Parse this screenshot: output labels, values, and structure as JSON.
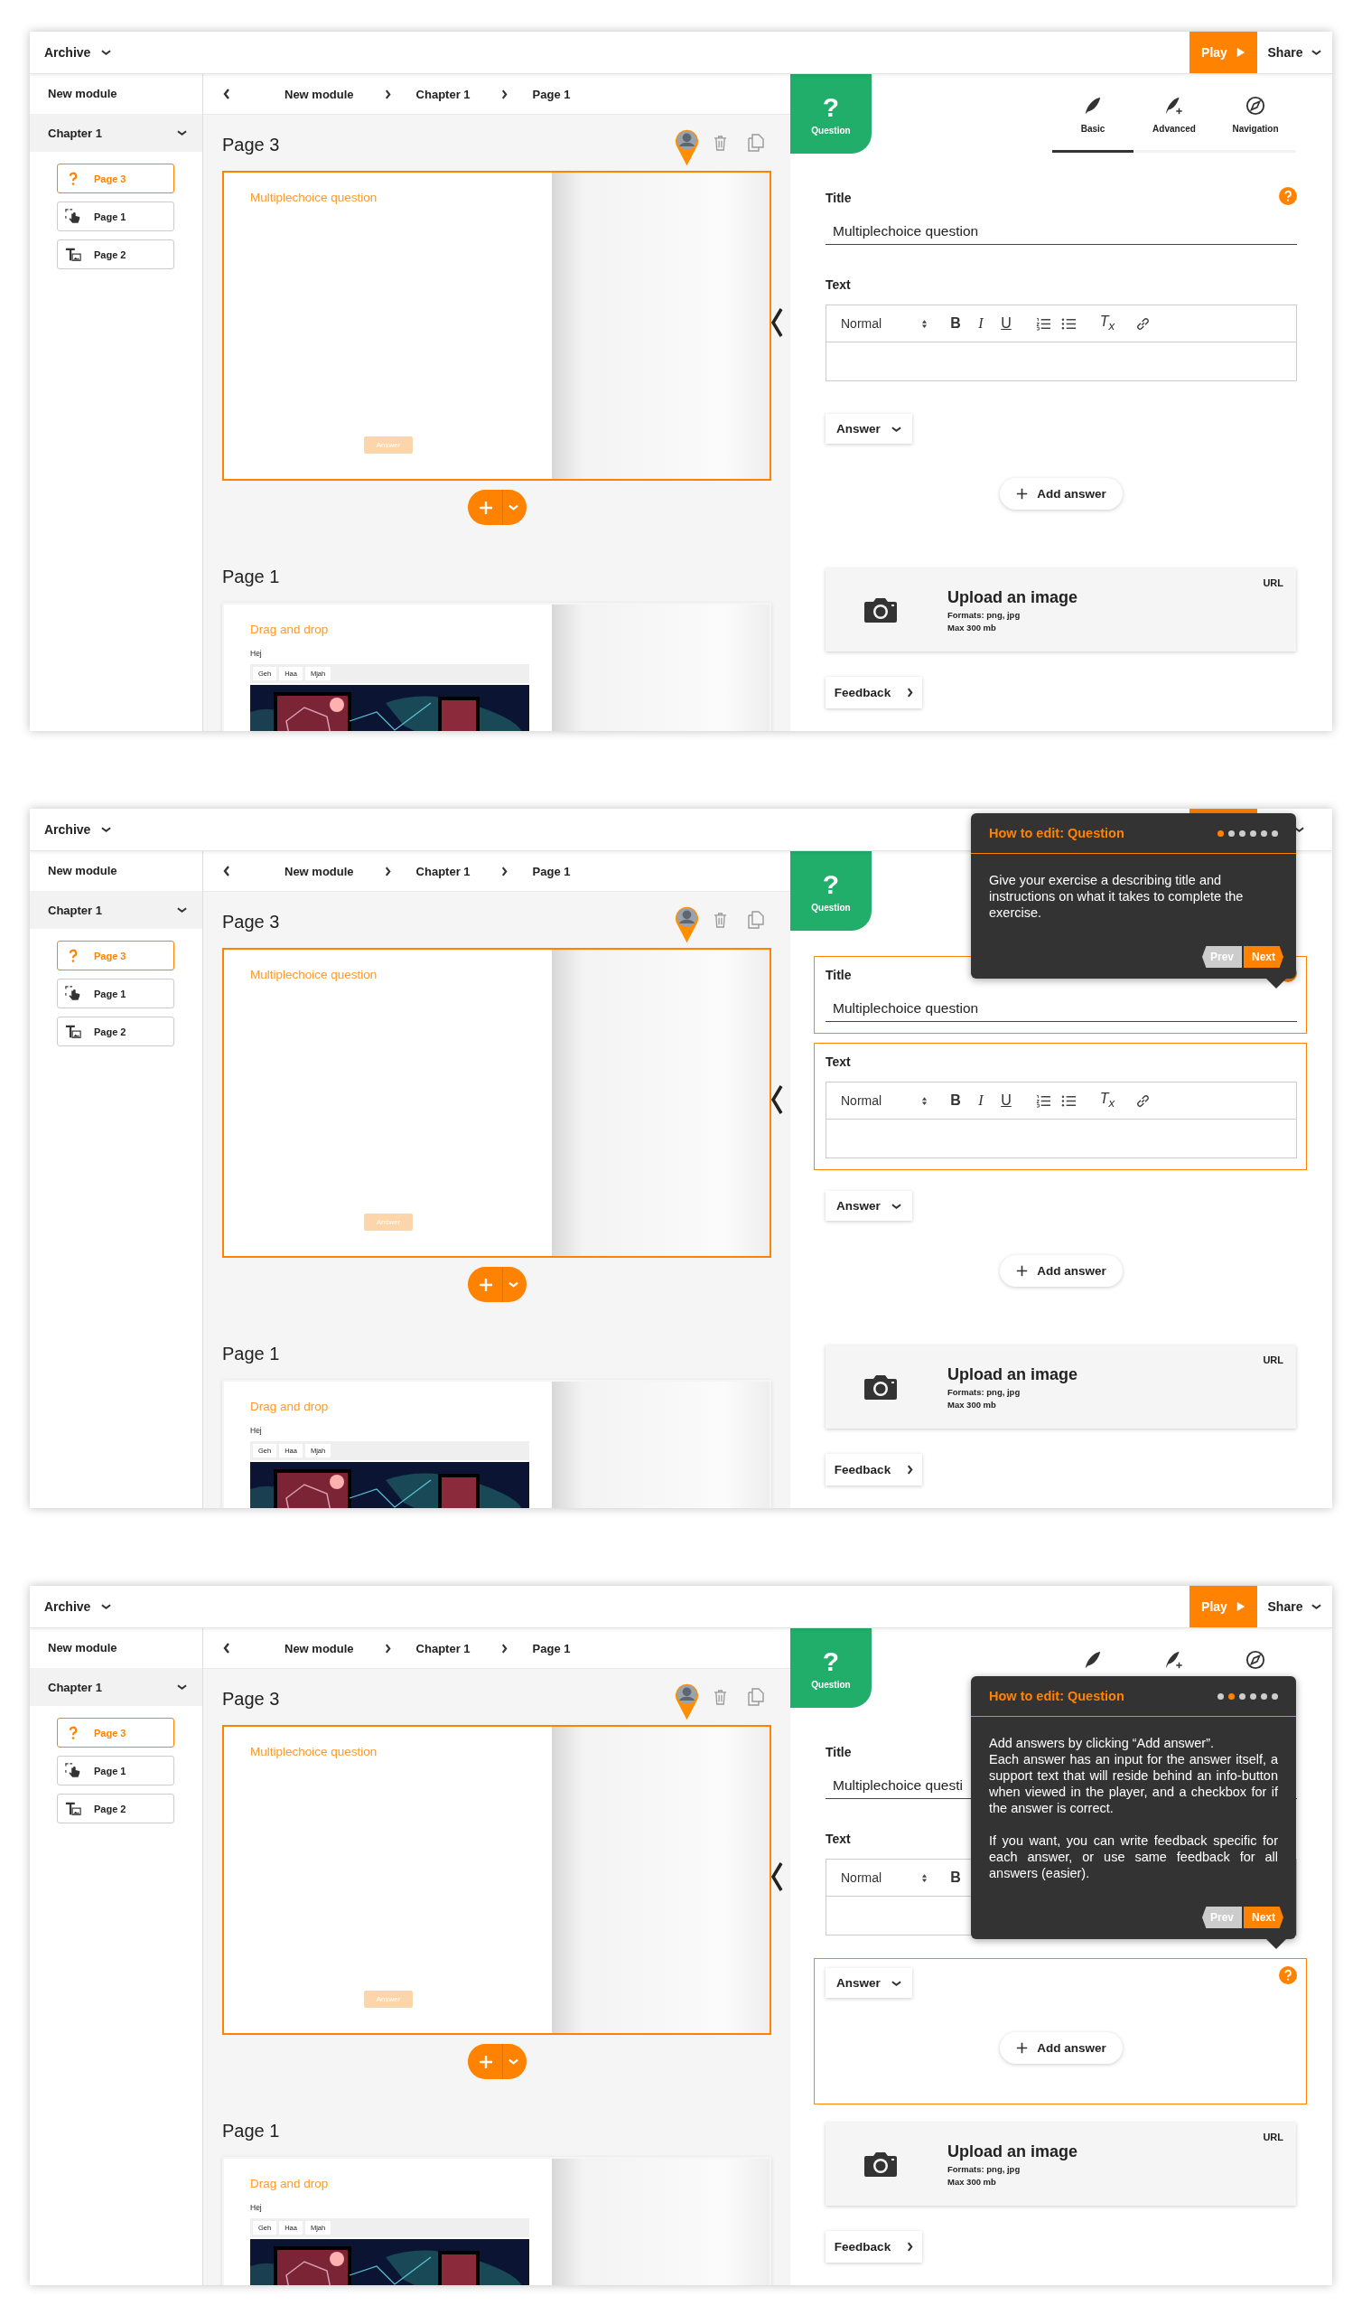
{
  "screens": [
    {
      "topbar": {
        "archive": "Archive",
        "play": "Play",
        "share": "Share"
      },
      "sidebar": {
        "module": "New module",
        "chapter": {
          "label": "Chapter 1",
          "expanded": true
        },
        "pages": [
          {
            "label": "Page 3",
            "kind": "question",
            "selected": true
          },
          {
            "label": "Page 1",
            "kind": "dragdrop",
            "selected": false
          },
          {
            "label": "Page 2",
            "kind": "textimage",
            "selected": false
          }
        ]
      },
      "breadcrumb": [
        "New module",
        "Chapter 1",
        "Page 1"
      ],
      "pages": [
        {
          "heading": "Page 3",
          "kind": "question",
          "selected": true,
          "title": "Multiplechoice question",
          "button": "Answer"
        },
        {
          "heading": "Page 1",
          "kind": "dragdrop",
          "selected": false,
          "title": "Drag and drop",
          "text": "Hej",
          "chips": [
            "Geh",
            "Haa",
            "Mjah"
          ]
        }
      ],
      "editor": {
        "badge": {
          "glyph": "?",
          "label": "Question"
        },
        "tabs": [
          {
            "kind": "feather",
            "label": "Basic",
            "selected": true
          },
          {
            "kind": "feather-plus",
            "label": "Advanced",
            "selected": false
          },
          {
            "kind": "compass",
            "label": "Navigation",
            "selected": false
          }
        ],
        "title_section": {
          "label": "Title",
          "value": "Multiplechoice question",
          "help": true,
          "highlighted": false
        },
        "text_section": {
          "label": "Text",
          "format": "Normal",
          "highlighted": false,
          "tools": [
            {
              "kind": "bold",
              "glyph": "B"
            },
            {
              "kind": "italic",
              "glyph": "I"
            },
            {
              "kind": "underline",
              "glyph": "U"
            },
            {
              "kind": "ordered-list"
            },
            {
              "kind": "bullet-list"
            },
            {
              "kind": "clear-format",
              "glyph": "T$_{x}$"
            },
            {
              "kind": "link"
            }
          ]
        },
        "answer_section": {
          "dropdown": "Answer",
          "add": "Add answer",
          "help": false,
          "highlighted": false
        },
        "upload": {
          "title": "Upload an image",
          "formats": "Formats: png, jpg",
          "max": "Max 300 mb",
          "url": "URL"
        },
        "feedback": "Feedback"
      }
    },
    {
      "topbar": {
        "archive": "Archive"
      },
      "sidebar": {
        "module": "New module",
        "chapter": {
          "label": "Chapter 1",
          "expanded": true
        },
        "pages": [
          {
            "label": "Page 3",
            "kind": "question",
            "selected": true
          },
          {
            "label": "Page 1",
            "kind": "dragdrop",
            "selected": false
          },
          {
            "label": "Page 2",
            "kind": "textimage",
            "selected": false
          }
        ]
      },
      "breadcrumb": [
        "New module",
        "Chapter 1",
        "Page 1"
      ],
      "pages": [
        {
          "heading": "Page 3",
          "kind": "question",
          "selected": true,
          "title": "Multiplechoice question",
          "button": "Answer"
        },
        {
          "heading": "Page 1",
          "kind": "dragdrop",
          "selected": false,
          "title": "Drag and drop",
          "text": "Hej",
          "chips": [
            "Geh",
            "Haa",
            "Mjah"
          ]
        }
      ],
      "editor": {
        "badge": {
          "glyph": "?",
          "label": "Question"
        },
        "title_section": {
          "label": "Title",
          "value": "Multiplechoice question",
          "help": true,
          "highlighted": true
        },
        "text_section": {
          "label": "Text",
          "format": "Normal",
          "highlighted": true,
          "tools": [
            {
              "kind": "bold",
              "glyph": "B"
            },
            {
              "kind": "italic",
              "glyph": "I"
            },
            {
              "kind": "underline",
              "glyph": "U"
            },
            {
              "kind": "ordered-list"
            },
            {
              "kind": "bullet-list"
            },
            {
              "kind": "clear-format",
              "glyph": "T$_{x}$"
            },
            {
              "kind": "link"
            }
          ]
        },
        "answer_section": {
          "dropdown": "Answer",
          "add": "Add answer",
          "help": false,
          "highlighted": false
        },
        "upload": {
          "title": "Upload an image",
          "formats": "Formats: png, jpg",
          "max": "Max 300 mb",
          "url": "URL"
        },
        "feedback": "Feedback"
      },
      "tooltip": {
        "kind": "title-step",
        "title": "How to edit: Question",
        "steps": [
          {
            "selected": true
          },
          {
            "selected": false
          },
          {
            "selected": false
          },
          {
            "selected": false
          },
          {
            "selected": false
          },
          {
            "selected": false
          }
        ],
        "paragraphs": [
          "Give your exercise a describing title and instructions on what it takes to complete the exercise."
        ],
        "prev": "Prev",
        "next": "Next"
      }
    },
    {
      "topbar": {
        "archive": "Archive",
        "play": "Play",
        "share": "Share"
      },
      "sidebar": {
        "module": "New module",
        "chapter": {
          "label": "Chapter 1",
          "expanded": true
        },
        "pages": [
          {
            "label": "Page 3",
            "kind": "question",
            "selected": true
          },
          {
            "label": "Page 1",
            "kind": "dragdrop",
            "selected": false
          },
          {
            "label": "Page 2",
            "kind": "textimage",
            "selected": false
          }
        ]
      },
      "breadcrumb": [
        "New module",
        "Chapter 1",
        "Page 1"
      ],
      "pages": [
        {
          "heading": "Page 3",
          "kind": "question",
          "selected": true,
          "title": "Multiplechoice question",
          "button": "Answer"
        },
        {
          "heading": "Page 1",
          "kind": "dragdrop",
          "selected": false,
          "title": "Drag and drop",
          "text": "Hej",
          "chips": [
            "Geh",
            "Haa",
            "Mjah"
          ]
        }
      ],
      "editor": {
        "badge": {
          "glyph": "?",
          "label": "Question"
        },
        "tabs": [
          {
            "kind": "feather"
          },
          {
            "kind": "feather-plus"
          },
          {
            "kind": "compass"
          }
        ],
        "title_section": {
          "label": "Title",
          "value": "Multiplechoice questi",
          "help": false,
          "highlighted": false
        },
        "text_section": {
          "label": "Text",
          "format": "Normal",
          "highlighted": false,
          "tools": [
            {
              "kind": "bold",
              "glyph": "B"
            }
          ]
        },
        "answer_section": {
          "dropdown": "Answer",
          "add": "Add answer",
          "help": true,
          "highlighted": true
        },
        "upload": {
          "title": "Upload an image",
          "formats": "Formats: png, jpg",
          "max": "Max 300 mb",
          "url": "URL"
        },
        "feedback": "Feedback"
      },
      "tooltip": {
        "kind": "answer-step",
        "title": "How to edit: Question",
        "steps": [
          {
            "selected": false
          },
          {
            "selected": true
          },
          {
            "selected": false
          },
          {
            "selected": false
          },
          {
            "selected": false
          },
          {
            "selected": false
          }
        ],
        "paragraphs": [
          "Add answers by clicking “Add answer”.\nEach answer has an input for the answer itself, a support text that will reside behind an info-button when viewed in the player, and a checkbox for if the answer is correct.",
          "If you want, you can write feedback specific for each answer, or use same feedback for all answers (easier)."
        ],
        "prev": "Prev",
        "next": "Next"
      }
    }
  ]
}
